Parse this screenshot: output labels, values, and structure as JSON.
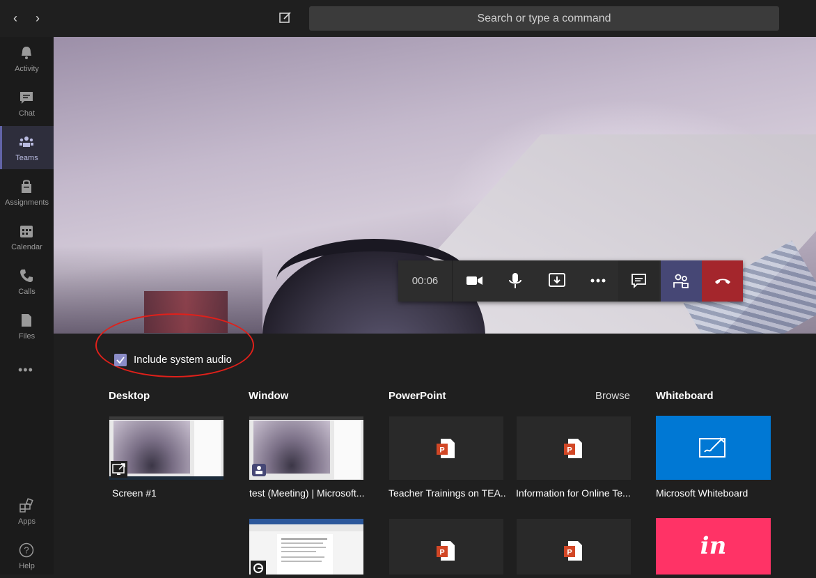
{
  "search": {
    "placeholder": "Search or type a command"
  },
  "rail": {
    "items": [
      {
        "label": "Activity"
      },
      {
        "label": "Chat"
      },
      {
        "label": "Teams"
      },
      {
        "label": "Assignments"
      },
      {
        "label": "Calendar"
      },
      {
        "label": "Calls"
      },
      {
        "label": "Files"
      }
    ],
    "more": "•••",
    "apps": "Apps",
    "help": "Help"
  },
  "call": {
    "timer": "00:06",
    "icons": [
      "video-camera-icon",
      "microphone-icon",
      "share-tray-icon",
      "more-actions-icon",
      "chat-icon",
      "participants-icon",
      "hang-up-icon"
    ],
    "colors": {
      "people": "#464775",
      "hangup": "#a4262c"
    }
  },
  "share": {
    "include_audio_label": "Include system audio",
    "include_audio_checked": true,
    "sections": {
      "desktop": "Desktop",
      "window": "Window",
      "powerpoint": "PowerPoint",
      "browse": "Browse",
      "whiteboard": "Whiteboard"
    },
    "tiles": {
      "desktop": [
        "Screen #1"
      ],
      "window": [
        "test (Meeting) | Microsoft..."
      ],
      "powerpoint": [
        "Teacher Trainings on TEA...",
        "Information for Online Te..."
      ],
      "whiteboard": [
        "Microsoft Whiteboard"
      ],
      "invision_logo": "in"
    },
    "colors": {
      "whiteboard": "#0078d4",
      "invision": "#ff3366",
      "checkbox": "#8b8cc7",
      "annotation": "#e0201a"
    }
  }
}
